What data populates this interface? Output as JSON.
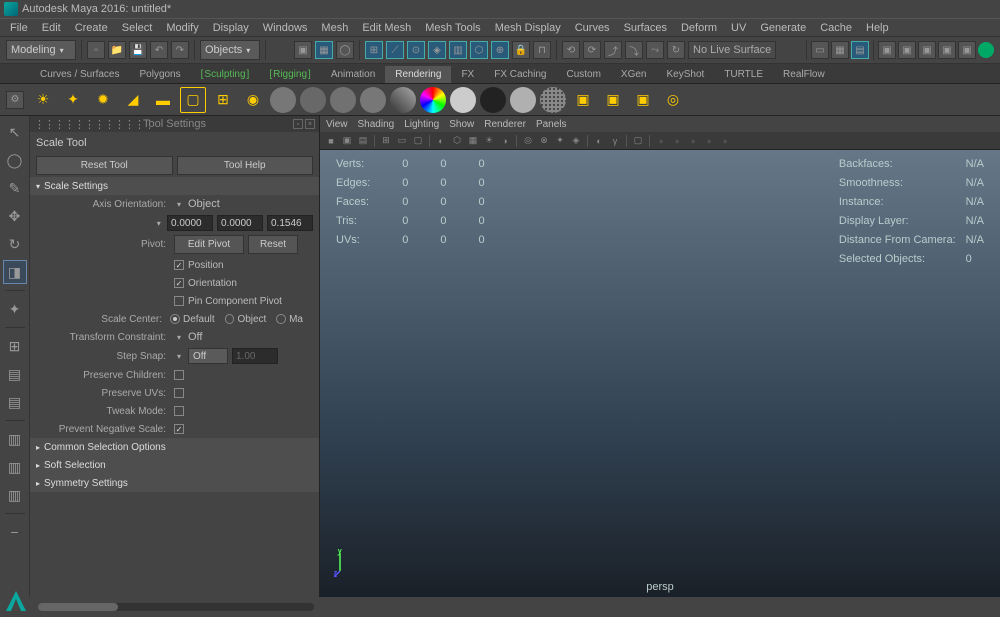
{
  "title": "Autodesk Maya 2016: untitled*",
  "menubar": [
    "File",
    "Edit",
    "Create",
    "Select",
    "Modify",
    "Display",
    "Windows",
    "Mesh",
    "Edit Mesh",
    "Mesh Tools",
    "Mesh Display",
    "Curves",
    "Surfaces",
    "Deform",
    "UV",
    "Generate",
    "Cache",
    "Help"
  ],
  "workspace_mode": "Modeling",
  "object_mode": "Objects",
  "no_live_surface": "No Live Surface",
  "shelf_tabs": [
    {
      "label": "Curves / Surfaces",
      "style": ""
    },
    {
      "label": "Polygons",
      "style": ""
    },
    {
      "label": "Sculpting",
      "style": "bracket-green"
    },
    {
      "label": "Rigging",
      "style": "bracket-green"
    },
    {
      "label": "Animation",
      "style": ""
    },
    {
      "label": "Rendering",
      "style": "active"
    },
    {
      "label": "FX",
      "style": ""
    },
    {
      "label": "FX Caching",
      "style": ""
    },
    {
      "label": "Custom",
      "style": ""
    },
    {
      "label": "XGen",
      "style": ""
    },
    {
      "label": "KeyShot",
      "style": ""
    },
    {
      "label": "TURTLE",
      "style": ""
    },
    {
      "label": "RealFlow",
      "style": ""
    }
  ],
  "tool_settings": {
    "panel_title": "Tool Settings",
    "tool_name": "Scale Tool",
    "reset_tool": "Reset Tool",
    "tool_help": "Tool Help",
    "sections": {
      "scale": "Scale Settings",
      "common": "Common Selection Options",
      "soft": "Soft Selection",
      "sym": "Symmetry Settings"
    },
    "axis_orientation_lbl": "Axis Orientation:",
    "axis_orientation_val": "Object",
    "coords": [
      "0.0000",
      "0.0000",
      "0.1546"
    ],
    "pivot_lbl": "Pivot:",
    "edit_pivot": "Edit Pivot",
    "reset": "Reset",
    "cb_position": "Position",
    "cb_orientation": "Orientation",
    "cb_pin": "Pin Component Pivot",
    "scale_center_lbl": "Scale Center:",
    "radio_default": "Default",
    "radio_object": "Object",
    "radio_ma": "Ma",
    "transform_constraint_lbl": "Transform Constraint:",
    "transform_constraint_val": "Off",
    "step_snap_lbl": "Step Snap:",
    "step_snap_val": "Off",
    "step_snap_num": "1.00",
    "preserve_children": "Preserve Children:",
    "preserve_uvs": "Preserve UVs:",
    "tweak_mode": "Tweak Mode:",
    "prevent_neg": "Prevent Negative Scale:"
  },
  "viewport": {
    "menus": [
      "View",
      "Shading",
      "Lighting",
      "Show",
      "Renderer",
      "Panels"
    ],
    "hud_left_rows": [
      {
        "k": "Verts:",
        "a": "0",
        "b": "0",
        "c": "0"
      },
      {
        "k": "Edges:",
        "a": "0",
        "b": "0",
        "c": "0"
      },
      {
        "k": "Faces:",
        "a": "0",
        "b": "0",
        "c": "0"
      },
      {
        "k": "Tris:",
        "a": "0",
        "b": "0",
        "c": "0"
      },
      {
        "k": "UVs:",
        "a": "0",
        "b": "0",
        "c": "0"
      }
    ],
    "hud_right_rows": [
      {
        "k": "Backfaces:",
        "v": "N/A"
      },
      {
        "k": "Smoothness:",
        "v": "N/A"
      },
      {
        "k": "Instance:",
        "v": "N/A"
      },
      {
        "k": "Display Layer:",
        "v": "N/A"
      },
      {
        "k": "Distance From Camera:",
        "v": "N/A"
      },
      {
        "k": "Selected Objects:",
        "v": "0"
      }
    ],
    "camera": "persp",
    "gizmo_y": "y",
    "gizmo_z": "z"
  }
}
